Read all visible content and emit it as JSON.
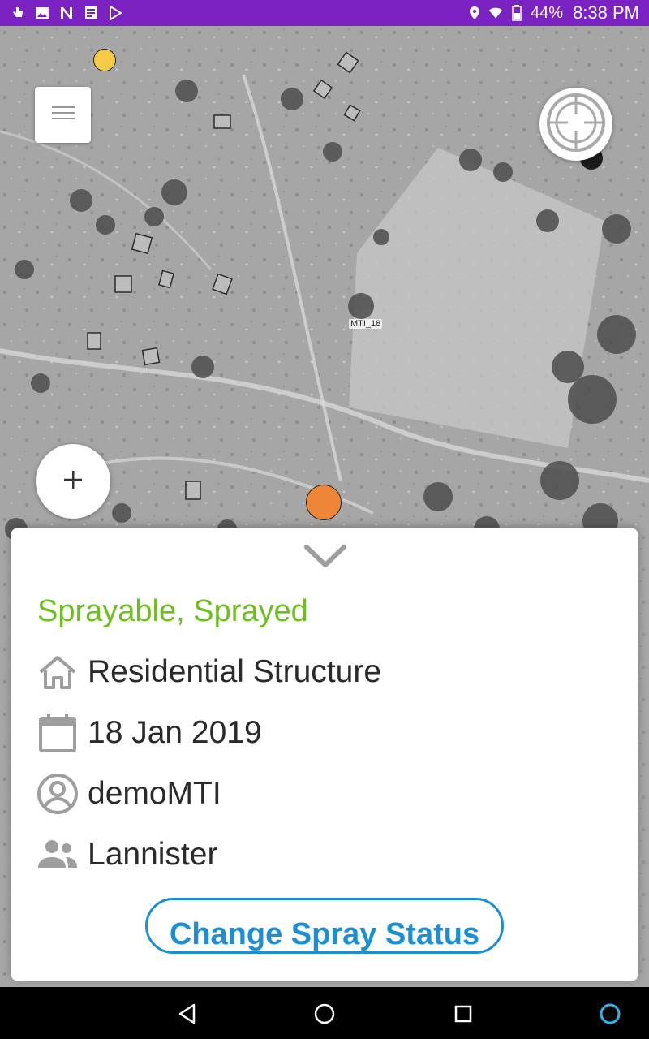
{
  "status_bar": {
    "battery": "44%",
    "time": "8:38 PM",
    "left_icons": [
      "hand-icon",
      "image-icon",
      "n-icon",
      "document-icon",
      "play-store-icon"
    ],
    "right_icons": [
      "location-icon",
      "wifi-icon",
      "battery-icon"
    ]
  },
  "map": {
    "structure_label": "MTI_18",
    "marker_colors": {
      "yellow": "#f3cb47",
      "black": "#1b1b1b",
      "orange": "#ef8536"
    }
  },
  "sheet": {
    "status": "Sprayable, Sprayed",
    "status_color": "#6bbf1e",
    "structure_type": "Residential Structure",
    "date": "18 Jan 2019",
    "user": "demoMTI",
    "team": "Lannister",
    "change_button": "Change Spray Status",
    "accent_color": "#1b8fd6"
  },
  "nav_bar": {
    "items": [
      "back-icon",
      "home-icon",
      "recents-icon",
      "assistant-icon"
    ]
  }
}
